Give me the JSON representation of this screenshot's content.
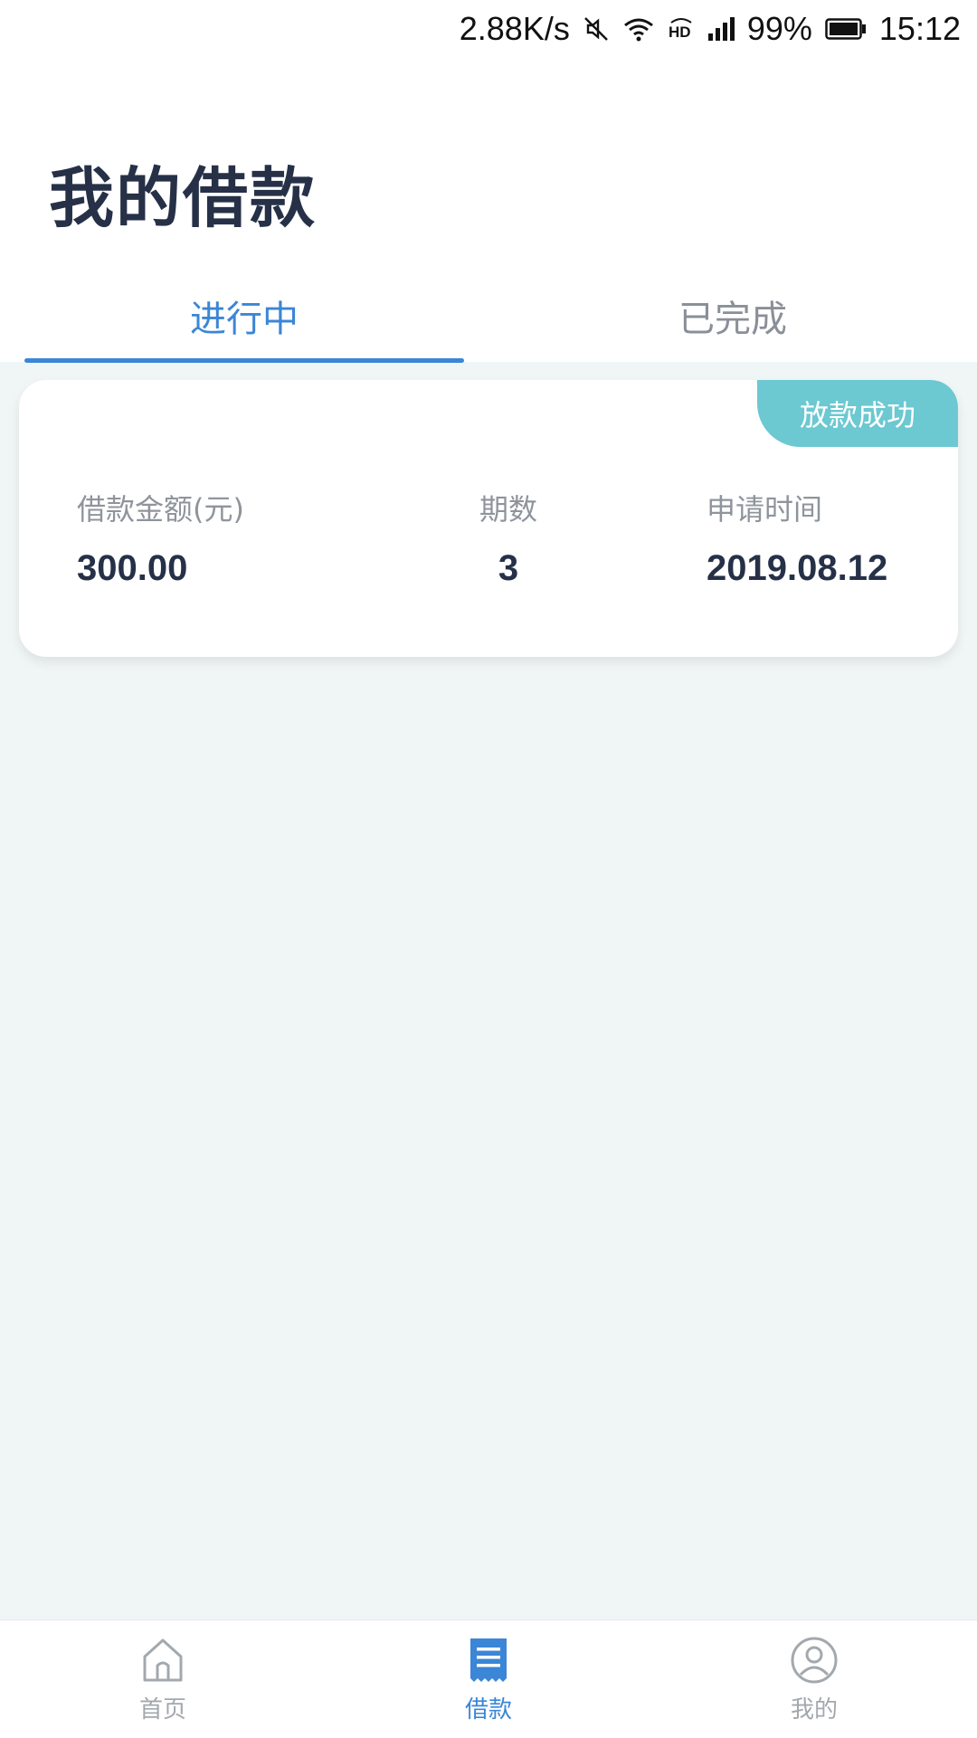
{
  "status_bar": {
    "net_speed": "2.88K/s",
    "battery": "99%",
    "time": "15:12",
    "icons": [
      "mute-icon",
      "wifi-icon",
      "hd-icon",
      "signal-icon",
      "battery-icon"
    ]
  },
  "header": {
    "title": "我的借款",
    "tabs": [
      {
        "label": "进行中",
        "active": true
      },
      {
        "label": "已完成",
        "active": false
      }
    ]
  },
  "loans": [
    {
      "status": "放款成功",
      "amount_label": "借款金额(元)",
      "amount": "300.00",
      "periods_label": "期数",
      "periods": "3",
      "date_label": "申请时间",
      "date": "2019.08.12"
    }
  ],
  "bottom_nav": {
    "items": [
      {
        "label": "首页",
        "icon": "home-icon",
        "active": false
      },
      {
        "label": "借款",
        "icon": "loan-icon",
        "active": true
      },
      {
        "label": "我的",
        "icon": "profile-icon",
        "active": false
      }
    ]
  },
  "colors": {
    "accent": "#3b86d6",
    "badge": "#6cc8d1",
    "background": "#f0f5f5",
    "text_dark": "#263148",
    "text_muted": "#8f949c"
  }
}
